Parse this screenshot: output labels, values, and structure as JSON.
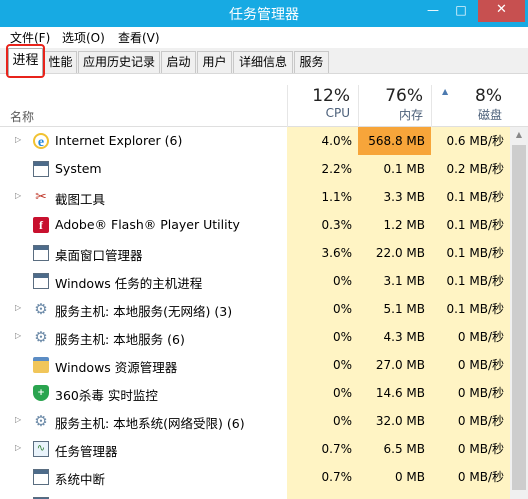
{
  "window": {
    "title": "任务管理器",
    "min_glyph": "—",
    "max_glyph": "□",
    "close_glyph": "✕"
  },
  "menu": [
    "文件(F)",
    "选项(O)",
    "查看(V)"
  ],
  "tabs": [
    "进程",
    "性能",
    "应用历史记录",
    "启动",
    "用户",
    "详细信息",
    "服务"
  ],
  "active_tab": "进程",
  "columns": {
    "name": "名称",
    "cpu": {
      "percent": "12%",
      "label": "CPU"
    },
    "memory": {
      "percent": "76%",
      "label": "内存"
    },
    "disk": {
      "percent": "8%",
      "label": "磁盘"
    }
  },
  "colors": {
    "titlebar": "#17aae3",
    "close_button": "#c75050",
    "heat_light": "#fff4c4",
    "heat_high": "#f7a53a",
    "highlight_box": "#e8231b"
  },
  "processes": [
    {
      "name": "Internet Explorer (6)",
      "icon": "internet-explorer-icon",
      "expandable": true,
      "cpu": "4.0%",
      "memory": "568.8 MB",
      "disk": "0.6 MB/秒",
      "memory_hot": true
    },
    {
      "name": "System",
      "icon": "window-icon",
      "expandable": false,
      "cpu": "2.2%",
      "memory": "0.1 MB",
      "disk": "0.2 MB/秒",
      "memory_hot": false
    },
    {
      "name": "截图工具",
      "icon": "snipping-tool-icon",
      "expandable": true,
      "cpu": "1.1%",
      "memory": "3.3 MB",
      "disk": "0.1 MB/秒",
      "memory_hot": false
    },
    {
      "name": "Adobe® Flash® Player Utility",
      "icon": "flash-icon",
      "expandable": false,
      "cpu": "0.3%",
      "memory": "1.2 MB",
      "disk": "0.1 MB/秒",
      "memory_hot": false
    },
    {
      "name": "桌面窗口管理器",
      "icon": "window-icon",
      "expandable": false,
      "cpu": "3.6%",
      "memory": "22.0 MB",
      "disk": "0.1 MB/秒",
      "memory_hot": false
    },
    {
      "name": "Windows 任务的主机进程",
      "icon": "window-icon",
      "expandable": false,
      "cpu": "0%",
      "memory": "3.1 MB",
      "disk": "0.1 MB/秒",
      "memory_hot": false
    },
    {
      "name": "服务主机: 本地服务(无网络) (3)",
      "icon": "gear-icon",
      "expandable": true,
      "cpu": "0%",
      "memory": "5.1 MB",
      "disk": "0.1 MB/秒",
      "memory_hot": false
    },
    {
      "name": "服务主机: 本地服务 (6)",
      "icon": "gear-icon",
      "expandable": true,
      "cpu": "0%",
      "memory": "4.3 MB",
      "disk": "0 MB/秒",
      "memory_hot": false
    },
    {
      "name": "Windows 资源管理器",
      "icon": "folder-icon",
      "expandable": false,
      "cpu": "0%",
      "memory": "27.0 MB",
      "disk": "0 MB/秒",
      "memory_hot": false
    },
    {
      "name": "360杀毒 实时监控",
      "icon": "shield-360-icon",
      "expandable": false,
      "cpu": "0%",
      "memory": "14.6 MB",
      "disk": "0 MB/秒",
      "memory_hot": false
    },
    {
      "name": "服务主机: 本地系统(网络受限) (6)",
      "icon": "gear-icon",
      "expandable": true,
      "cpu": "0%",
      "memory": "32.0 MB",
      "disk": "0 MB/秒",
      "memory_hot": false
    },
    {
      "name": "任务管理器",
      "icon": "task-manager-icon",
      "expandable": true,
      "cpu": "0.7%",
      "memory": "6.5 MB",
      "disk": "0 MB/秒",
      "memory_hot": false
    },
    {
      "name": "系统中断",
      "icon": "window-icon",
      "expandable": false,
      "cpu": "0.7%",
      "memory": "0 MB",
      "disk": "0 MB/秒",
      "memory_hot": false
    },
    {
      "name": "",
      "icon": "window-icon",
      "expandable": false,
      "cpu": "",
      "memory": "",
      "disk": "",
      "memory_hot": false
    }
  ]
}
